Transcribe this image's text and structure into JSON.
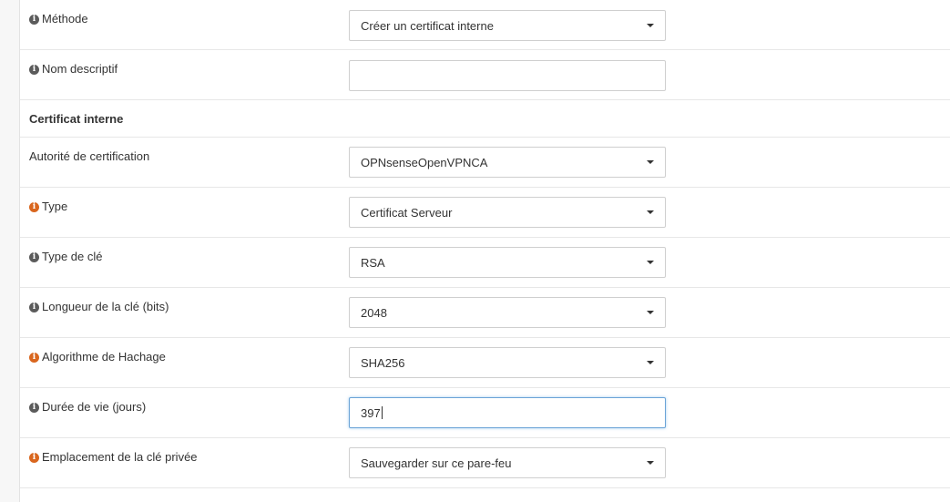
{
  "form": {
    "method": {
      "label": "Méthode",
      "value": "Créer un certificat interne",
      "icon": "info-icon",
      "icon_color": "#5b5b5b"
    },
    "descriptive_name": {
      "label": "Nom descriptif",
      "value": "",
      "icon": "info-icon",
      "icon_color": "#5b5b5b"
    },
    "section_title": "Certificat interne",
    "certificate_authority": {
      "label": "Autorité de certification",
      "value": "OPNsenseOpenVPNCA"
    },
    "type": {
      "label": "Type",
      "value": "Certificat Serveur",
      "icon": "info-icon",
      "icon_color": "#d9661e"
    },
    "key_type": {
      "label": "Type de clé",
      "value": "RSA",
      "icon": "info-icon",
      "icon_color": "#5b5b5b"
    },
    "key_length": {
      "label": "Longueur de la clé (bits)",
      "value": "2048",
      "icon": "info-icon",
      "icon_color": "#5b5b5b"
    },
    "digest_algorithm": {
      "label": "Algorithme de Hachage",
      "value": "SHA256",
      "icon": "info-icon",
      "icon_color": "#d9661e"
    },
    "lifetime": {
      "label": "Durée de vie (jours)",
      "value": "397",
      "icon": "info-icon",
      "icon_color": "#5b5b5b"
    },
    "private_key_location": {
      "label": "Emplacement de la clé privée",
      "value": "Sauvegarder sur ce pare-feu",
      "icon": "info-icon",
      "icon_color": "#d9661e"
    }
  }
}
